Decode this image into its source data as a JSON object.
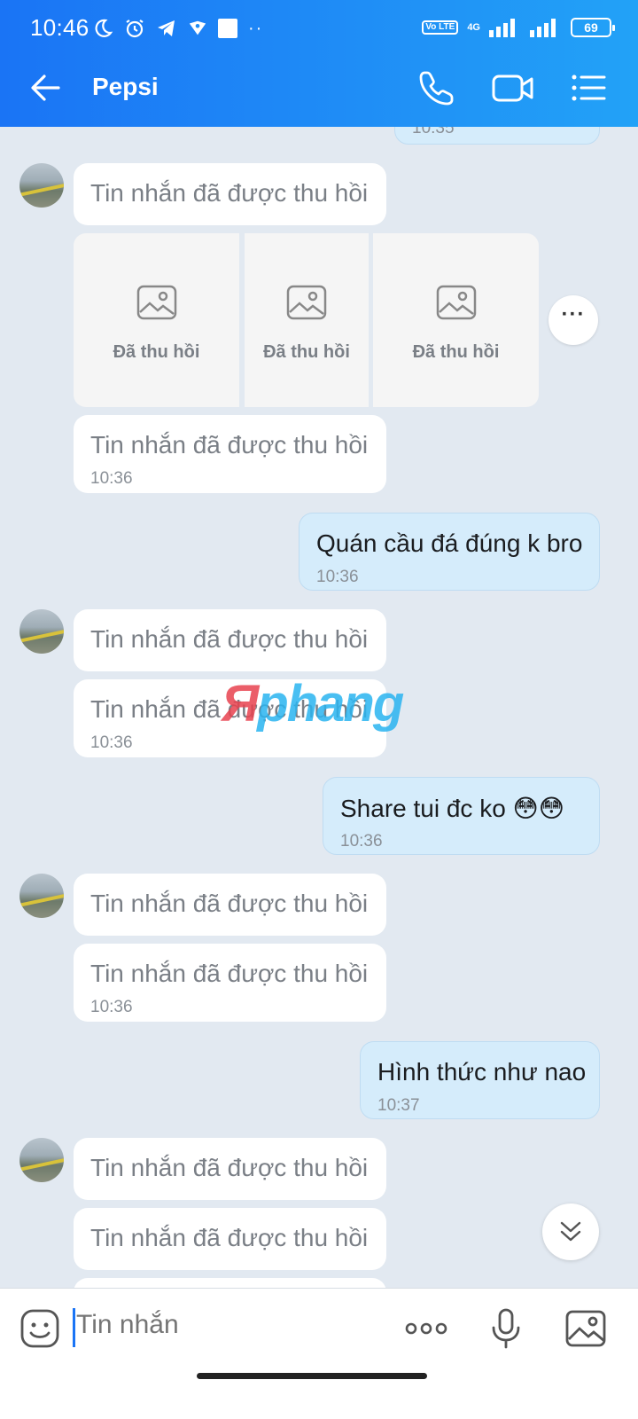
{
  "status_bar": {
    "time": "10:46",
    "network_label": "4G",
    "volte_label": "Vo LTE",
    "battery": "69"
  },
  "header": {
    "back_icon": "back-arrow-icon",
    "title": "Pepsi",
    "icons": [
      "phone-icon",
      "video-call-icon",
      "menu-list-icon"
    ],
    "gradient": [
      "#1a74f5",
      "#22a2f7"
    ]
  },
  "messages": {
    "clipped_time": "10:35",
    "recalled_text": "Tin nhắn đã được thu hồi",
    "image_recalled_label": "Đã thu hồi",
    "m1_time": "10:36",
    "s1_text": "Quán cầu đá đúng k bro",
    "s1_time": "10:36",
    "m2_time": "10:36",
    "s2_text": "Share tui đc ko 😳😳",
    "s2_time": "10:36",
    "m3_time": "10:36",
    "s3_text": "Hình thức như nao",
    "s3_time": "10:37"
  },
  "watermark": {
    "text_a": "Я",
    "text_b": "phang"
  },
  "composer": {
    "placeholder": "Tin nhắn",
    "icons": [
      "emoji-icon",
      "more-dots-icon",
      "microphone-icon",
      "gallery-icon"
    ]
  },
  "colors": {
    "chat_background": "#e2e9f1",
    "received_bubble": "#ffffff",
    "sent_bubble": "#d5ecfb"
  }
}
